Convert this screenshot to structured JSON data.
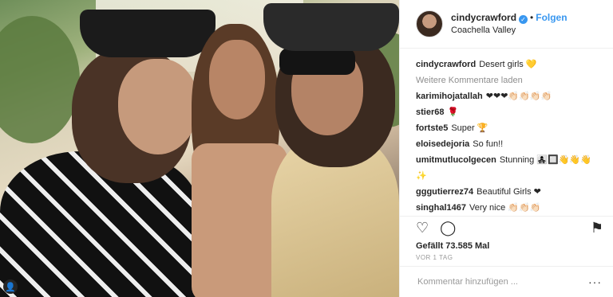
{
  "header": {
    "username": "cindycrawford",
    "verified_glyph": "✓",
    "separator": "•",
    "follow_label": "Folgen",
    "location": "Coachella Valley"
  },
  "caption": {
    "username": "cindycrawford",
    "text": "Desert girls 💛"
  },
  "load_more_label": "Weitere Kommentare laden",
  "comments": [
    {
      "username": "karimihojatallah",
      "text": "❤❤❤👏🏻👏🏻👏🏻👏🏻"
    },
    {
      "username": "stier68",
      "text": "🌹"
    },
    {
      "username": "fortste5",
      "text": "Super 🏆"
    },
    {
      "username": "eloisedejoria",
      "text": "So fun!!"
    },
    {
      "username": "umitmutlucolgecen",
      "text": "Stunning 👩‍👧‍👧🔲👋👋👋✨"
    },
    {
      "username": "gggutierrez74",
      "text": "Beautiful Girls ❤"
    },
    {
      "username": "singhal1467",
      "text": "Very nice 👏🏻👏🏻👏🏻"
    }
  ],
  "actions": {
    "like_icon": "♡",
    "comment_icon": "◯",
    "save_icon": "⚑"
  },
  "likes_text": "Gefällt 73.585 Mal",
  "timestamp": "VOR 1 TAG",
  "add_comment": {
    "placeholder": "Kommentar hinzufügen ...",
    "menu_icon": "···"
  },
  "user_tag_icon": "👤"
}
